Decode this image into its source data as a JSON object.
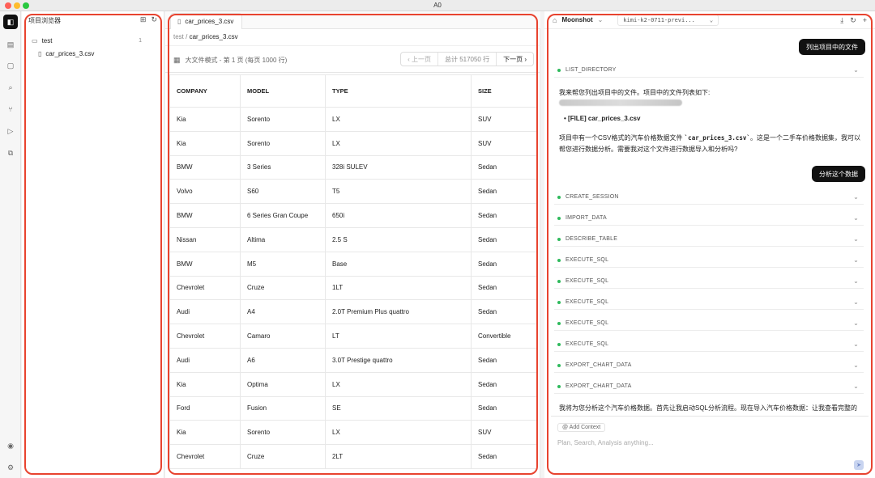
{
  "window": {
    "title": "A0"
  },
  "rail": {
    "icons": [
      "app-logo-icon",
      "explorer-icon",
      "chat-icon",
      "search-icon",
      "branch-icon",
      "run-icon",
      "extensions-icon",
      "account-icon",
      "settings-icon"
    ]
  },
  "explorer": {
    "title": "项目浏览器",
    "tree": [
      {
        "name": "test",
        "kind": "folder",
        "count": "1"
      },
      {
        "name": "car_prices_3.csv",
        "kind": "file"
      }
    ]
  },
  "editor": {
    "tab_label": "car_prices_3.csv",
    "breadcrumb": {
      "folder": "test",
      "separator": "/",
      "file": "car_prices_3.csv"
    },
    "mode_info": "大文件模式 - 第 1 页 (每页 1000 行)",
    "pager": {
      "prev": "‹ 上一页",
      "total": "总计 517050 行",
      "next": "下一页 ›"
    },
    "columns": [
      "COMPANY",
      "MODEL",
      "TYPE",
      "SIZE"
    ],
    "rows": [
      [
        "Kia",
        "Sorento",
        "LX",
        "SUV"
      ],
      [
        "Kia",
        "Sorento",
        "LX",
        "SUV"
      ],
      [
        "BMW",
        "3 Series",
        "328i SULEV",
        "Sedan"
      ],
      [
        "Volvo",
        "S60",
        "T5",
        "Sedan"
      ],
      [
        "BMW",
        "6 Series Gran Coupe",
        "650i",
        "Sedan"
      ],
      [
        "Nissan",
        "Altima",
        "2.5 S",
        "Sedan"
      ],
      [
        "BMW",
        "M5",
        "Base",
        "Sedan"
      ],
      [
        "Chevrolet",
        "Cruze",
        "1LT",
        "Sedan"
      ],
      [
        "Audi",
        "A4",
        "2.0T Premium Plus quattro",
        "Sedan"
      ],
      [
        "Chevrolet",
        "Camaro",
        "LT",
        "Convertible"
      ],
      [
        "Audi",
        "A6",
        "3.0T Prestige quattro",
        "Sedan"
      ],
      [
        "Kia",
        "Optima",
        "LX",
        "Sedan"
      ],
      [
        "Ford",
        "Fusion",
        "SE",
        "Sedan"
      ],
      [
        "Kia",
        "Sorento",
        "LX",
        "SUV"
      ],
      [
        "Chevrolet",
        "Cruze",
        "2LT",
        "Sedan"
      ]
    ]
  },
  "chat": {
    "provider": "Moonshot",
    "model": "kimi-k2-0711-previ...",
    "user_msg_1": "列出项目中的文件",
    "tool_1": "LIST_DIRECTORY",
    "reply_1_intro": "我来帮您列出项目中的文件。项目中的文件列表如下:",
    "reply_1_item": "[FILE] car_prices_3.csv",
    "reply_1_body_a": "项目中有一个CSV格式的汽车价格数据文件 ",
    "reply_1_code": "`car_prices_3.csv`",
    "reply_1_body_b": "。这是一个二手车价格数据集，我可以帮您进行数据分析。需要我对这个文件进行数据导入和分析吗?",
    "user_msg_2": "分析这个数据",
    "tools_2": [
      "CREATE_SESSION",
      "IMPORT_DATA",
      "DESCRIBE_TABLE",
      "EXECUTE_SQL",
      "EXECUTE_SQL",
      "EXECUTE_SQL",
      "EXECUTE_SQL",
      "EXECUTE_SQL",
      "EXPORT_CHART_DATA",
      "EXPORT_CHART_DATA"
    ],
    "reply_2": "我将为您分析这个汽车价格数据。首先让我启动SQL分析流程。现在导入汽车价格数据：让我查看完整的",
    "add_context": "@ Add Context",
    "input_placeholder": "Plan, Search, Analysis anything..."
  },
  "colors": {
    "accent_green": "#2fba5c",
    "annotation_red": "#e8432f",
    "bubble": "#111111"
  }
}
